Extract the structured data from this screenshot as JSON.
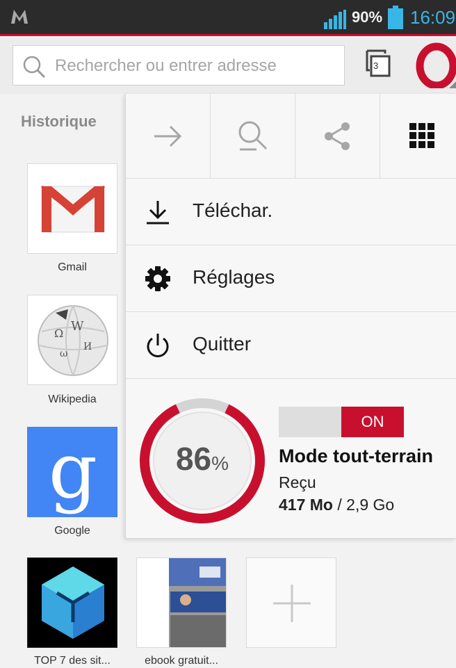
{
  "status_bar": {
    "battery_percent": "90%",
    "time": "16:09",
    "colors": {
      "background": "#2b2b2b",
      "accent": "#38b6e6"
    }
  },
  "address_bar": {
    "placeholder": "Rechercher ou entrer adresse",
    "tabs_count": "3"
  },
  "speed_dial": {
    "history_label": "Historique",
    "left_column": [
      {
        "label": "Gmail",
        "icon": "gmail-logo"
      },
      {
        "label": "Wikipedia",
        "icon": "wikipedia-globe"
      },
      {
        "label": "Google",
        "icon": "google-g-logo"
      }
    ],
    "bottom_row": [
      {
        "label": "TOP 7 des sit...",
        "icon": "cube-logo"
      },
      {
        "label": "ebook gratuit...",
        "icon": "website-thumbnail"
      },
      {
        "label": "",
        "icon": "add-icon"
      }
    ]
  },
  "menu": {
    "toolbar": [
      {
        "icon": "arrow-right-icon"
      },
      {
        "icon": "find-in-page-icon"
      },
      {
        "icon": "share-icon"
      },
      {
        "icon": "grid-icon"
      }
    ],
    "items": [
      {
        "label": "Téléchar.",
        "icon": "download-icon"
      },
      {
        "label": "Réglages",
        "icon": "gear-icon"
      },
      {
        "label": "Quitter",
        "icon": "power-icon"
      }
    ],
    "offroad": {
      "percent": 86,
      "percent_value": "86",
      "percent_sign": "%",
      "toggle_label": "ON",
      "title": "Mode tout-terrain",
      "subtitle": "Reçu",
      "received": "417 Mo",
      "total": " / 2,9 Go"
    }
  },
  "colors": {
    "brand_red": "#c8102e"
  }
}
